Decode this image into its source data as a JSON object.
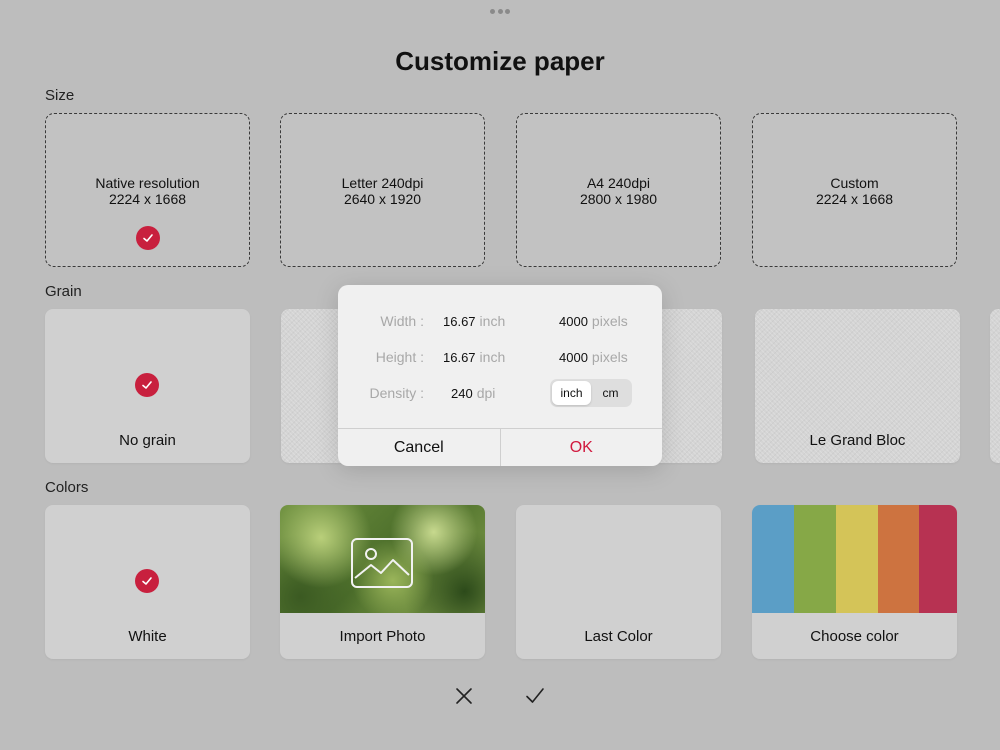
{
  "title": "Customize paper",
  "sections": {
    "size": "Size",
    "grain": "Grain",
    "colors": "Colors"
  },
  "sizes": [
    {
      "name": "Native resolution",
      "dims": "2224 x 1668",
      "selected": true
    },
    {
      "name": "Letter 240dpi",
      "dims": "2640 x 1920",
      "selected": false
    },
    {
      "name": "A4 240dpi",
      "dims": "2800 x 1980",
      "selected": false
    },
    {
      "name": "Custom",
      "dims": "2224 x 1668",
      "selected": false
    }
  ],
  "grains": [
    {
      "name": "No grain",
      "selected": true
    },
    {
      "name": "Le Grand Bloc",
      "selected": false
    }
  ],
  "colors_tiles": [
    {
      "name": "White",
      "selected": true
    },
    {
      "name": "Import Photo",
      "icon": "image-icon"
    },
    {
      "name": "Last Color"
    },
    {
      "name": "Choose color",
      "swatches": [
        "#5b9ec6",
        "#86a847",
        "#d4c458",
        "#cd7340",
        "#b73252"
      ]
    }
  ],
  "dialog": {
    "width_label": "Width :",
    "width_value": "16.67",
    "width_unit": "inch",
    "width_px": "4000",
    "px_unit": "pixels",
    "height_label": "Height :",
    "height_value": "16.67",
    "height_unit": "inch",
    "height_px": "4000",
    "density_label": "Density :",
    "density_value": "240",
    "density_unit": "dpi",
    "unit_options": [
      "inch",
      "cm"
    ],
    "selected_unit": "inch",
    "cancel": "Cancel",
    "ok": "OK"
  },
  "accent": "#c8203e",
  "bottom": {
    "cancel_icon": "close-icon",
    "confirm_icon": "checkmark-icon"
  }
}
